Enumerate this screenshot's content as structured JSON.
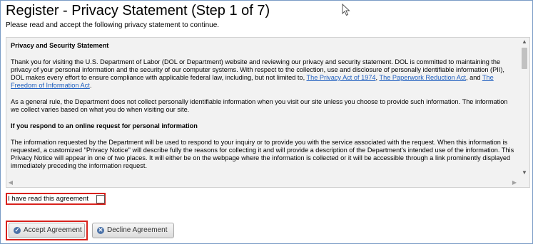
{
  "page": {
    "title": "Register - Privacy Statement (Step 1 of 7)",
    "subtitle": "Please read and accept the following privacy statement to continue."
  },
  "statement": {
    "heading": "Privacy and Security Statement",
    "para1_start": "Thank you for visiting the U.S. Department of Labor (DOL or Department) website and reviewing our privacy and security statement. DOL is committed to maintaining the privacy of your personal information and the security of our computer systems. With respect to the collection, use and disclosure of personally identifiable information (PII), DOL makes every effort to ensure compliance with applicable federal law, including, but not limited to, ",
    "link_privacy_act": "The Privacy Act of 1974",
    "sep1": ", ",
    "link_paperwork": "The Paperwork Reduction Act",
    "sep2": ", and ",
    "link_foia": "The Freedom of Information Act",
    "end1": ".",
    "para2": "As a general rule, the Department does not collect personally identifiable information when you visit our site unless you choose to provide such information. The information we collect varies based on what you do when visiting our site.",
    "heading2": "If you respond to an online request for personal information",
    "para3": "The information requested by the Department will be used to respond to your inquiry or to provide you with the service associated with the request. When this information is requested, a customized \"Privacy Notice\" will describe fully the reasons for collecting it and will provide a description of the Department's intended use of the information. This Privacy Notice will appear in one of two places. It will either be on the webpage where the information is collected or it will be accessible through a link prominently displayed immediately preceding the information request."
  },
  "agreement": {
    "label": "I have read this agreement",
    "checked": false
  },
  "buttons": {
    "accept": "Accept Agreement",
    "decline": "Decline Agreement"
  },
  "icons": {
    "accept": "check-circle-icon",
    "decline": "x-circle-icon"
  },
  "colors": {
    "highlight": "#d9221d",
    "link": "#1f5fbf"
  }
}
